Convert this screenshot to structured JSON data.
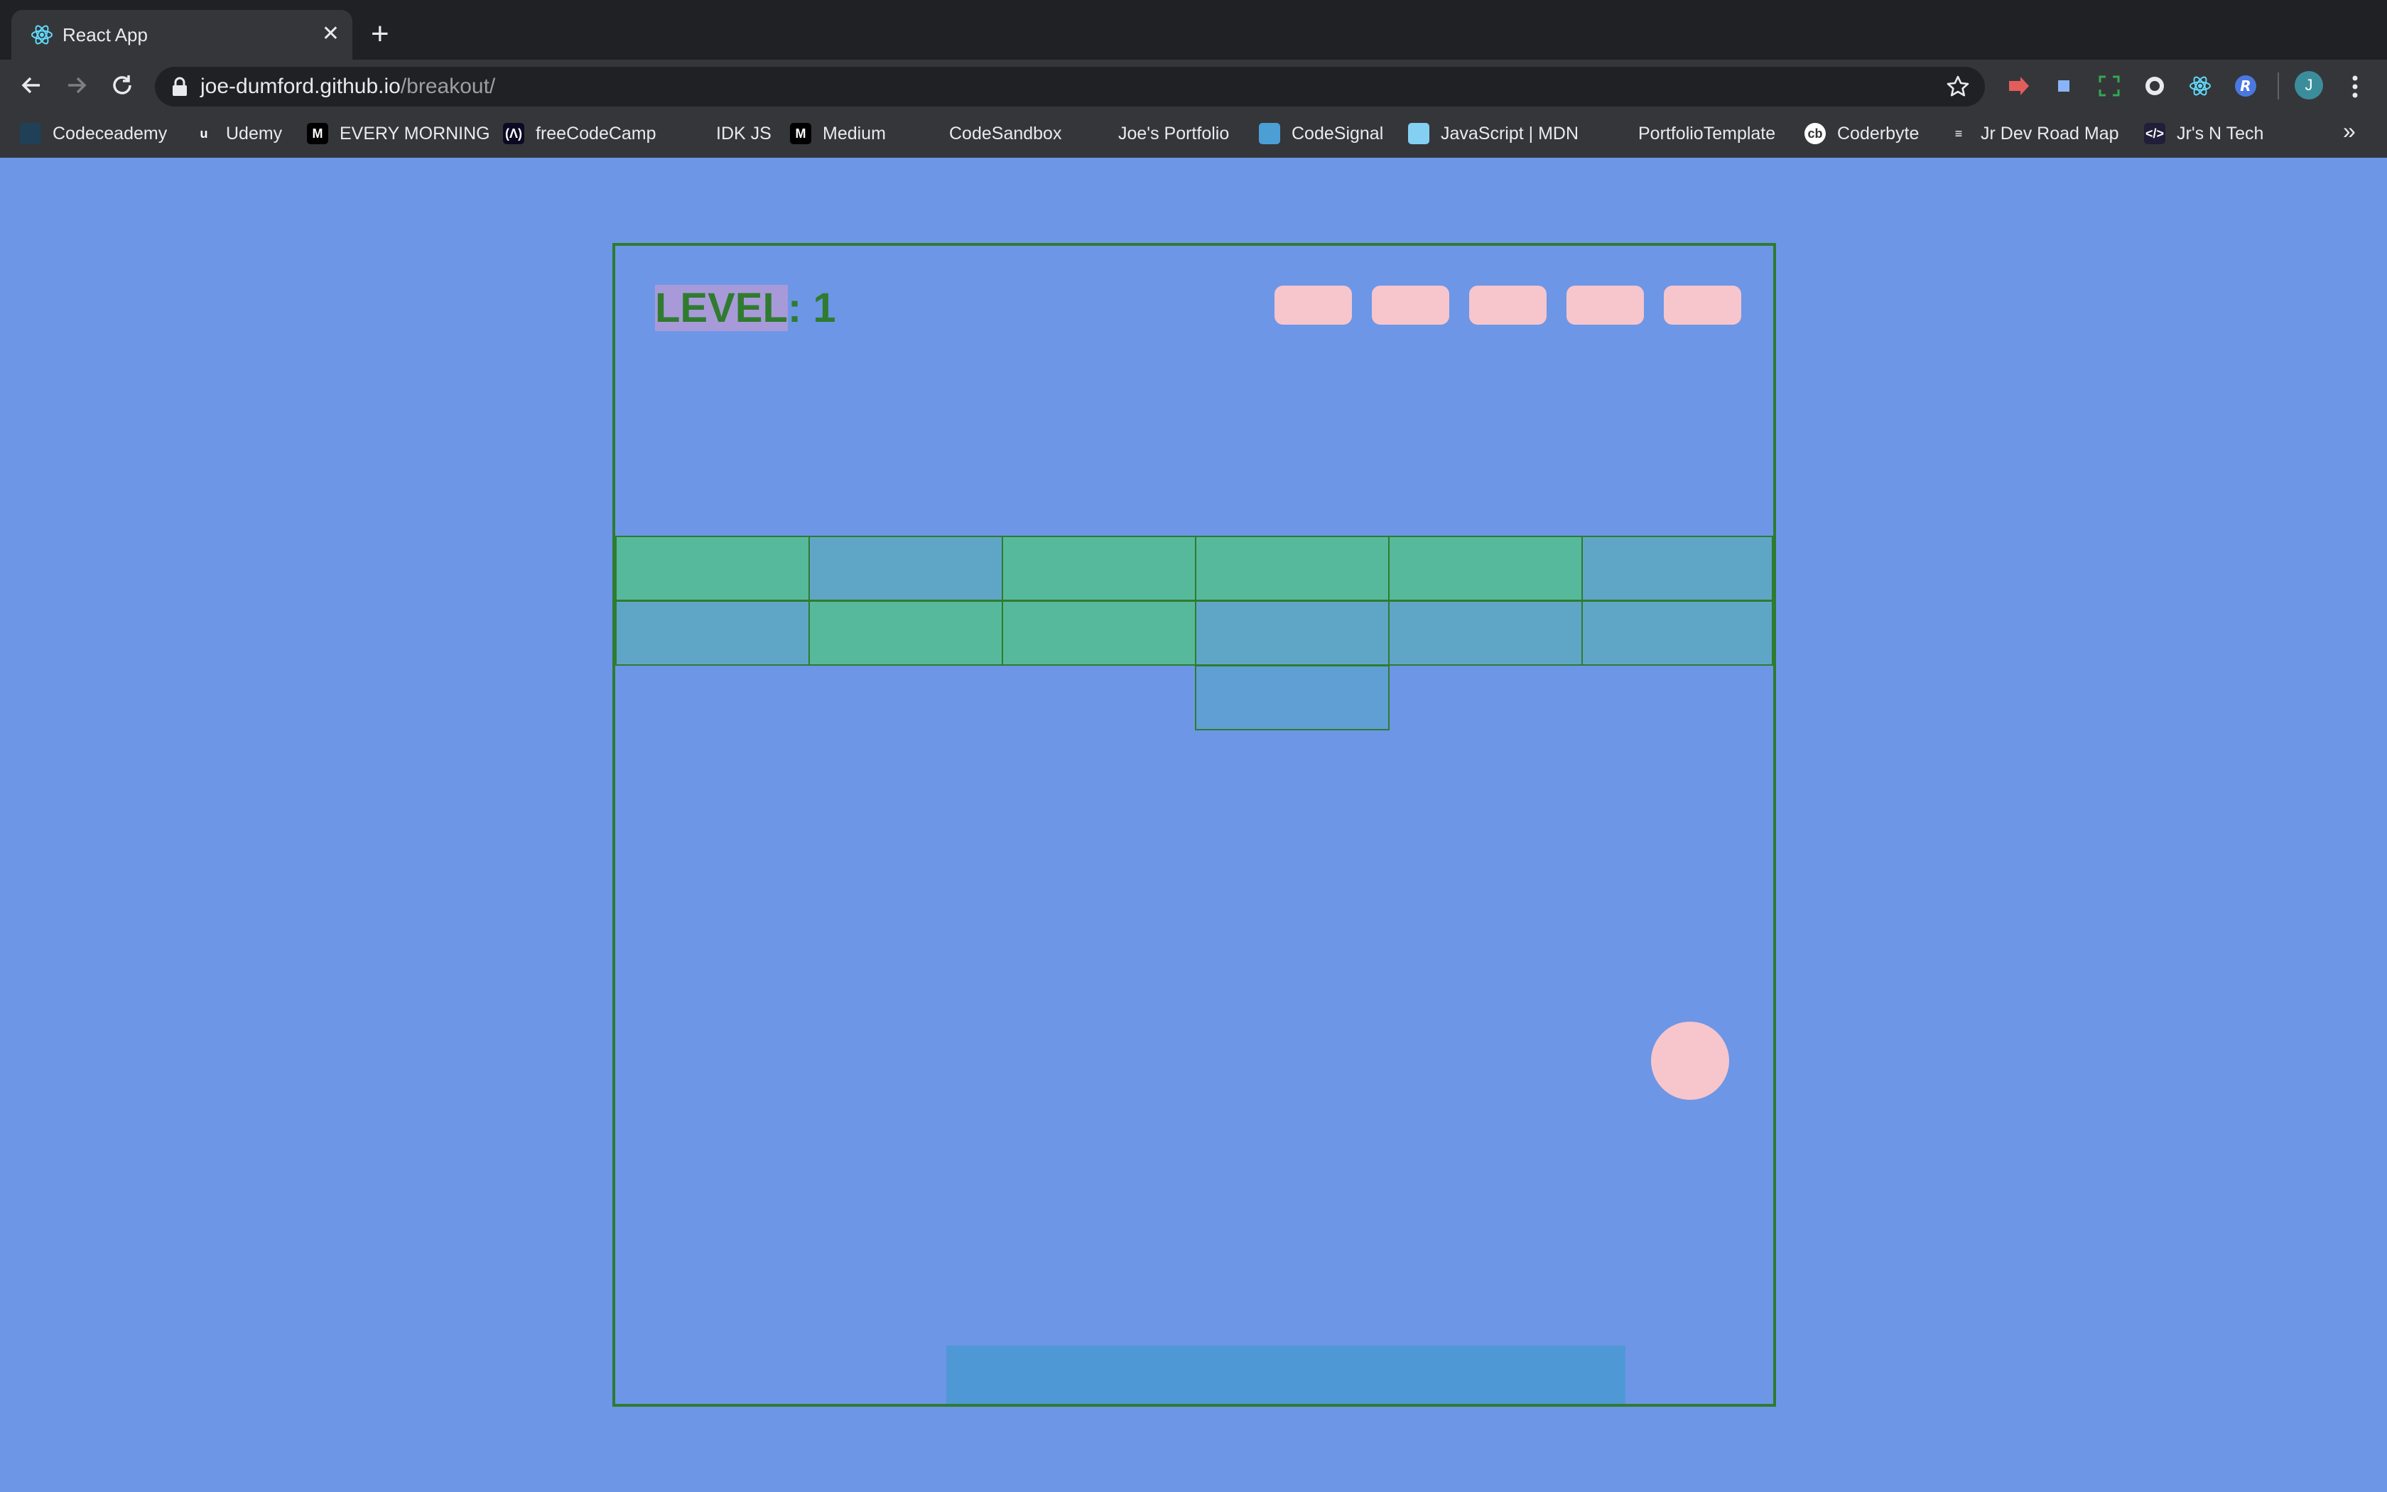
{
  "browser": {
    "tab": {
      "title": "React App",
      "favicon": "react-icon",
      "close_glyph": "✕"
    },
    "new_tab_glyph": "+",
    "url": {
      "host": "joe-dumford.github.io",
      "path": "/breakout/"
    },
    "extensions": [
      "ext-red-arrow-icon",
      "ext-blue-square-icon",
      "ext-screenshot-icon",
      "ext-circle-icon",
      "ext-react-devtools-icon",
      "ext-r-icon"
    ],
    "profile_initial": "J"
  },
  "bookmarks": [
    {
      "label": "Codeceademy",
      "icon": "codecademy-icon",
      "color": "#1f4056",
      "glyph": ""
    },
    {
      "label": "Udemy",
      "icon": "udemy-icon",
      "color": "#35363a",
      "glyph": "u"
    },
    {
      "label": "EVERY MORNING",
      "icon": "medium-icon",
      "color": "#000000",
      "glyph": "M"
    },
    {
      "label": "freeCodeCamp",
      "icon": "freecodecamp-icon",
      "color": "#0a0a23",
      "glyph": "(Λ)"
    },
    {
      "label": "IDK JS",
      "icon": "github-icon",
      "color": "#35363a",
      "glyph": ""
    },
    {
      "label": "Medium",
      "icon": "medium-icon",
      "color": "#000000",
      "glyph": "M"
    },
    {
      "label": "CodeSandbox",
      "icon": "codesandbox-icon",
      "color": "#35363a",
      "glyph": ""
    },
    {
      "label": "Joe's Portfolio",
      "icon": "globe-icon",
      "color": "#35363a",
      "glyph": ""
    },
    {
      "label": "CodeSignal",
      "icon": "codesignal-icon",
      "color": "#4b9fd5",
      "glyph": ""
    },
    {
      "label": "JavaScript | MDN",
      "icon": "mdn-icon",
      "color": "#83d0f2",
      "glyph": ""
    },
    {
      "label": "PortfolioTemplate",
      "icon": "github-icon",
      "color": "#35363a",
      "glyph": ""
    },
    {
      "label": "Coderbyte",
      "icon": "coderbyte-icon",
      "color": "#ffffff",
      "glyph": "cb"
    },
    {
      "label": "Jr Dev Road Map",
      "icon": "roadmap-icon",
      "color": "#35363a",
      "glyph": "≡"
    },
    {
      "label": "Jr's N Tech",
      "icon": "jrsntech-icon",
      "color": "#1f1f3a",
      "glyph": "</>"
    }
  ],
  "bookmarks_overflow": "»",
  "game": {
    "level_label": "LEVEL",
    "level_sep": ": ",
    "level_value": "1",
    "lives_remaining": 5,
    "colors": {
      "background": "#6d96e6",
      "border": "#2f7b2f",
      "green_brick": "#57b99b",
      "blue_brick": "#5fa6c6",
      "lone_brick": "#5f9fd4",
      "ball": "#f7c5cc",
      "paddle": "#4f98d6"
    },
    "brick_rows": [
      [
        "green",
        "blue",
        "green",
        "green",
        "green",
        "blue"
      ],
      [
        "blue",
        "green",
        "green",
        "blue",
        "blue",
        "blue"
      ],
      [
        "",
        "",
        "",
        "lone",
        "",
        ""
      ]
    ]
  }
}
